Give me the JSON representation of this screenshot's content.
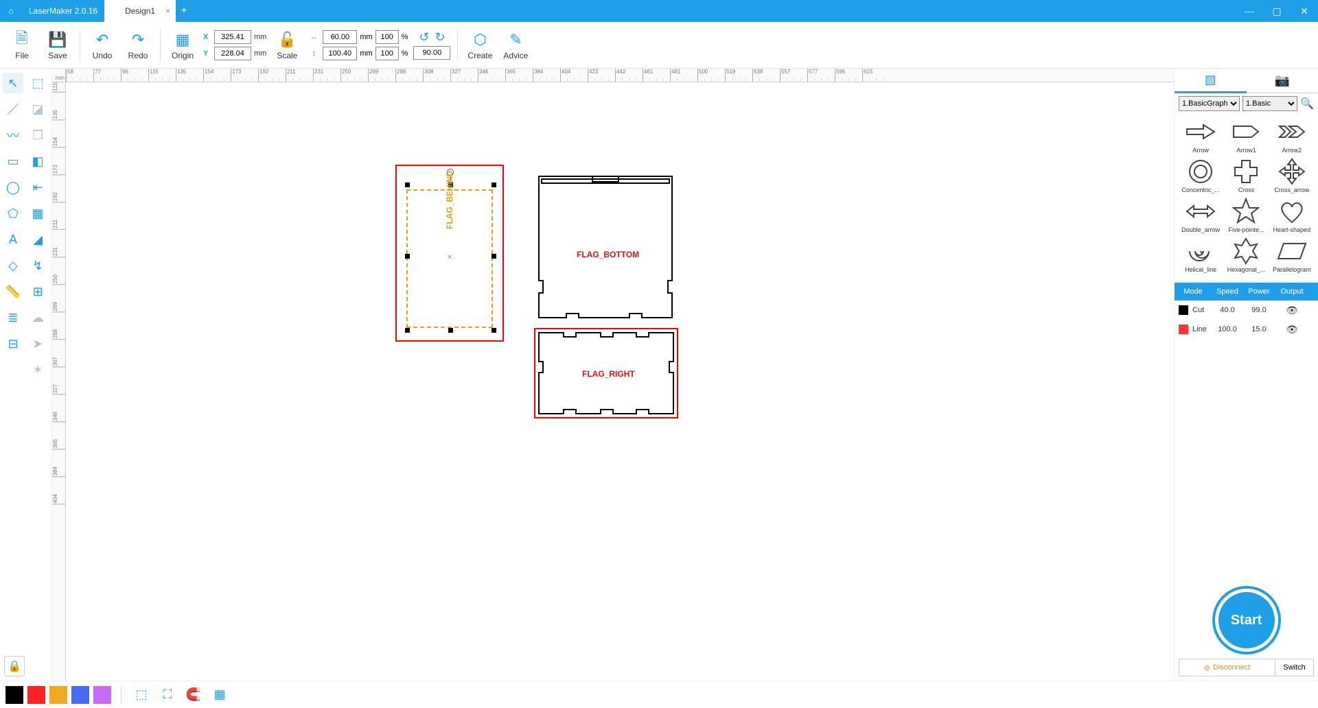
{
  "app": {
    "name": "LaserMaker 2.0.16",
    "tab": "Design1"
  },
  "toolbar": {
    "file": "File",
    "save": "Save",
    "undo": "Undo",
    "redo": "Redo",
    "origin": "Origin",
    "scale": "Scale",
    "create": "Create",
    "advice": "Advice",
    "x": "325.41",
    "y": "228.04",
    "mm": "mm",
    "w": "60.00",
    "h": "100.40",
    "pct1": "100",
    "pct2": "100",
    "pct": "%",
    "rot": "90.00"
  },
  "ruler": {
    "unit": "mm",
    "h": [
      "58",
      "77",
      "96",
      "115",
      "135",
      "154",
      "173",
      "192",
      "211",
      "231",
      "250",
      "269",
      "288",
      "308",
      "327",
      "346",
      "365",
      "384",
      "404",
      "423",
      "442",
      "461",
      "481",
      "500",
      "519",
      "538",
      "557",
      "577",
      "596",
      "615"
    ],
    "v": [
      "115",
      "135",
      "154",
      "173",
      "192",
      "211",
      "231",
      "250",
      "269",
      "288",
      "307",
      "327",
      "346",
      "365",
      "384",
      "404"
    ]
  },
  "canvas": {
    "selLabel": "FLAG_BEHIND",
    "bottomLabel": "FLAG_BOTTOM",
    "rightLabel": "FLAG_RIGHT"
  },
  "rightPanel": {
    "cat1": "1.BasicGraph",
    "cat2": "1.Basic",
    "shapes": [
      "Arrow",
      "Arrow1",
      "Arrow2",
      "Concentric_...",
      "Cross",
      "Cross_arrow",
      "Double_arrow",
      "Five-pointe...",
      "Heart-shaped",
      "Helical_line",
      "Hexagonal_...",
      "Parallelogram"
    ],
    "layerHeader": {
      "mode": "Mode",
      "speed": "Speed",
      "power": "Power",
      "output": "Output"
    },
    "layers": [
      {
        "color": "#000",
        "name": "Cut",
        "speed": "40.0",
        "power": "99.0"
      },
      {
        "color": "#f33",
        "name": "Line",
        "speed": "100.0",
        "power": "15.0"
      }
    ],
    "start": "Start",
    "disconnect": "Disconnect",
    "switch": "Switch"
  },
  "bottomColors": [
    "#000",
    "#f22",
    "#f5a623",
    "#4a6af5",
    "#c96af5"
  ]
}
